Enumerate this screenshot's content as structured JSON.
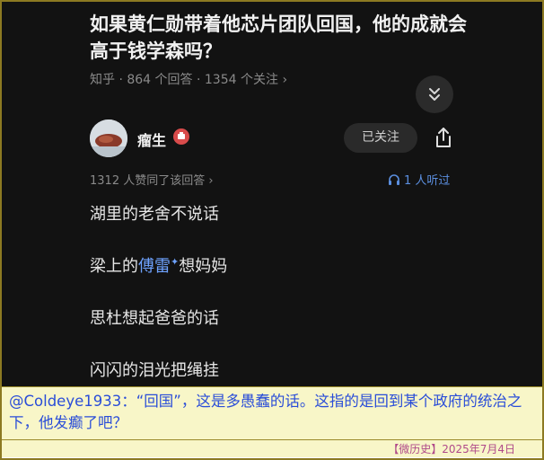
{
  "question": {
    "title": "如果黄仁勋带着他芯片团队回国，他的成就会高于钱学森吗？",
    "source": "知乎",
    "answer_count": "864 个回答",
    "follower_count": "1354 个关注",
    "meta_chevron": "›"
  },
  "author": {
    "name": "瘤生",
    "follow_label": "已关注"
  },
  "answer": {
    "likes_text": "1312 人赞同了该回答 ›",
    "listen_text": "1 人听过",
    "lines": {
      "l1": "湖里的老舍不说话",
      "l2_before": "梁上的",
      "l2_link": "傅雷",
      "l2_after": "想妈妈",
      "l3": "思杜想起爸爸的话",
      "l4": "闪闪的泪光把绳挂"
    }
  },
  "caption": {
    "text": "@Coldeye1933：“回国”，这是多愚蠢的话。这指的是回到某个政府的统治之下，他发癫了吧？"
  },
  "footer": {
    "text": "【微历史】2025年7月4日"
  },
  "colors": {
    "background": "#121212",
    "link": "#6ea2ff",
    "caption_text": "#2a4dd8",
    "caption_bg": "#f8f6c8",
    "footer_text": "#b04a8a"
  }
}
